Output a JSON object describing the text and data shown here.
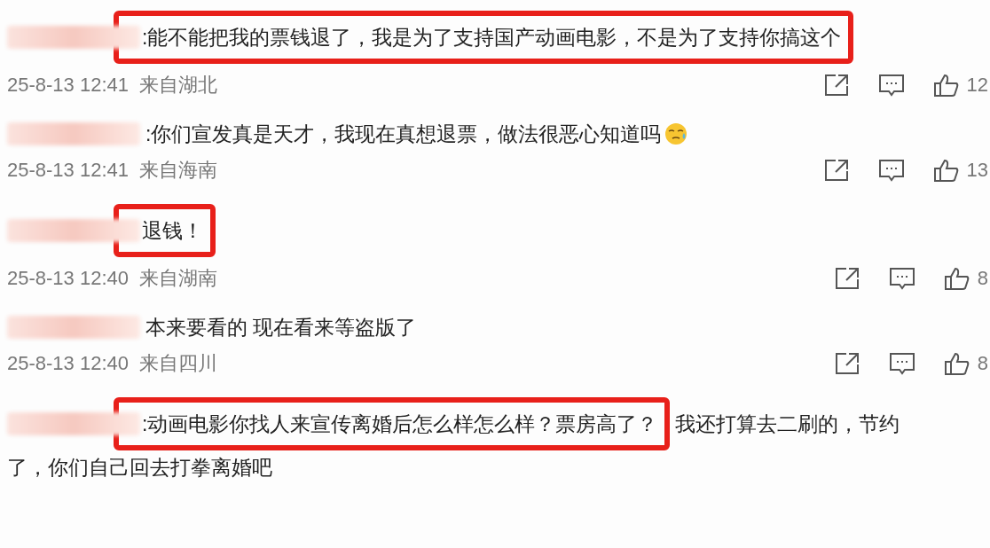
{
  "comments": [
    {
      "segments": [
        {
          "text": ":能不能把我的票钱退了，我是为了支持国产动画电影，不是为了支持你搞这个",
          "highlighted": true
        }
      ],
      "emoji": false,
      "date": "25-8-13 12:41",
      "location": "来自湖北",
      "likes": "12"
    },
    {
      "segments": [
        {
          "text": ":你们宣发真是天才，我现在真想退票，做法很恶心知道吗",
          "highlighted": false
        }
      ],
      "emoji": true,
      "date": "25-8-13 12:41",
      "location": "来自海南",
      "likes": "13"
    },
    {
      "segments": [
        {
          "text": "退钱！",
          "highlighted": true
        }
      ],
      "emoji": false,
      "date": "25-8-13 12:40",
      "location": "来自湖南",
      "likes": "8"
    },
    {
      "segments": [
        {
          "text": "本来要看的 现在看来等盗版了",
          "highlighted": false
        }
      ],
      "emoji": false,
      "date": "25-8-13 12:40",
      "location": "来自四川",
      "likes": "8"
    },
    {
      "segments": [
        {
          "text": ":动画电影你找人来宣传离婚后怎么样怎么样？票房高了？",
          "highlighted": true
        },
        {
          "text": "我还打算去二刷的，节约",
          "highlighted": false
        }
      ],
      "emoji": false,
      "text_line_2": "了，你们自己回去打拳离婚吧"
    }
  ]
}
